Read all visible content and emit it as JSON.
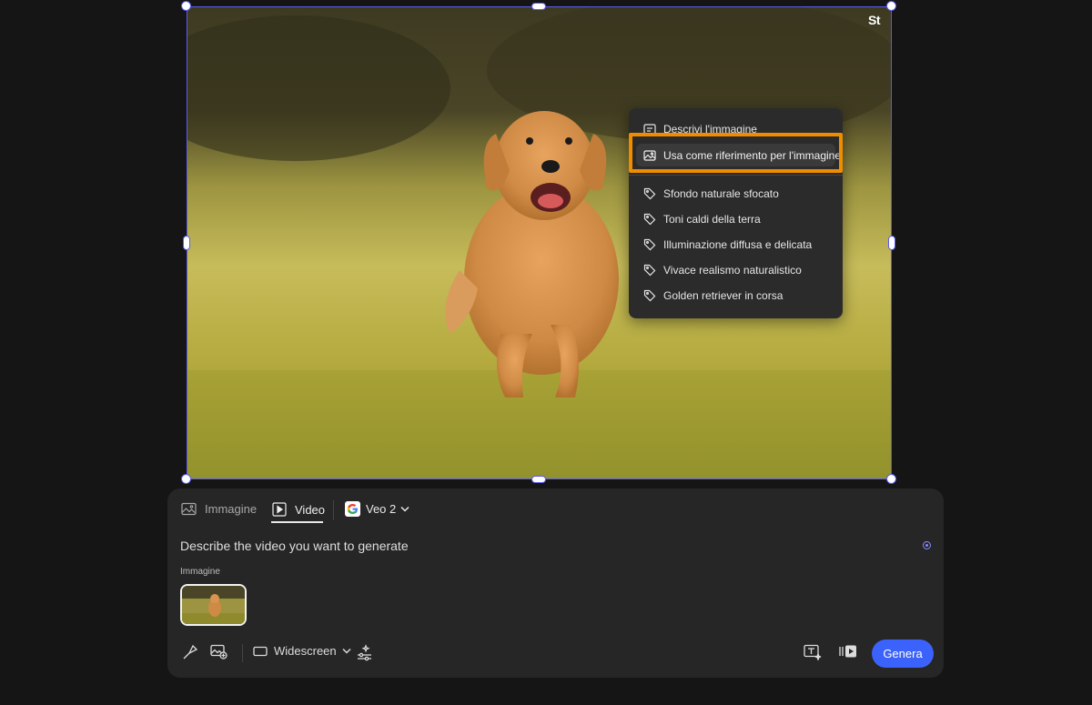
{
  "canvas": {
    "badge": "St"
  },
  "context_menu": {
    "items": [
      {
        "label": "Descrivi l'immagine",
        "icon": "describe-image-icon"
      },
      {
        "label": "Usa come riferimento per l'immagine",
        "icon": "image-icon",
        "selected": true
      }
    ],
    "tags": [
      {
        "label": "Sfondo naturale sfocato",
        "icon": "tag-icon"
      },
      {
        "label": "Toni caldi della terra",
        "icon": "tag-icon"
      },
      {
        "label": "Illuminazione diffusa e delicata",
        "icon": "tag-icon"
      },
      {
        "label": "Vivace realismo naturalistico",
        "icon": "tag-icon"
      },
      {
        "label": "Golden retriever in corsa",
        "icon": "tag-icon"
      }
    ],
    "highlight_color": "#f08c00"
  },
  "panel": {
    "tabs": [
      {
        "label": "Immagine",
        "icon": "image-icon",
        "active": false
      },
      {
        "label": "Video",
        "icon": "video-play-icon",
        "active": true
      }
    ],
    "model": {
      "label": "Veo 2",
      "icon": "google-icon"
    },
    "prompt_placeholder": "Describe the video you want to generate",
    "reference_label": "Immagine",
    "toolbar": {
      "aspect_label": "Widescreen",
      "generate_label": "Genera"
    }
  },
  "colors": {
    "accent": "#3b63fb",
    "selection": "#5b5bf0"
  }
}
